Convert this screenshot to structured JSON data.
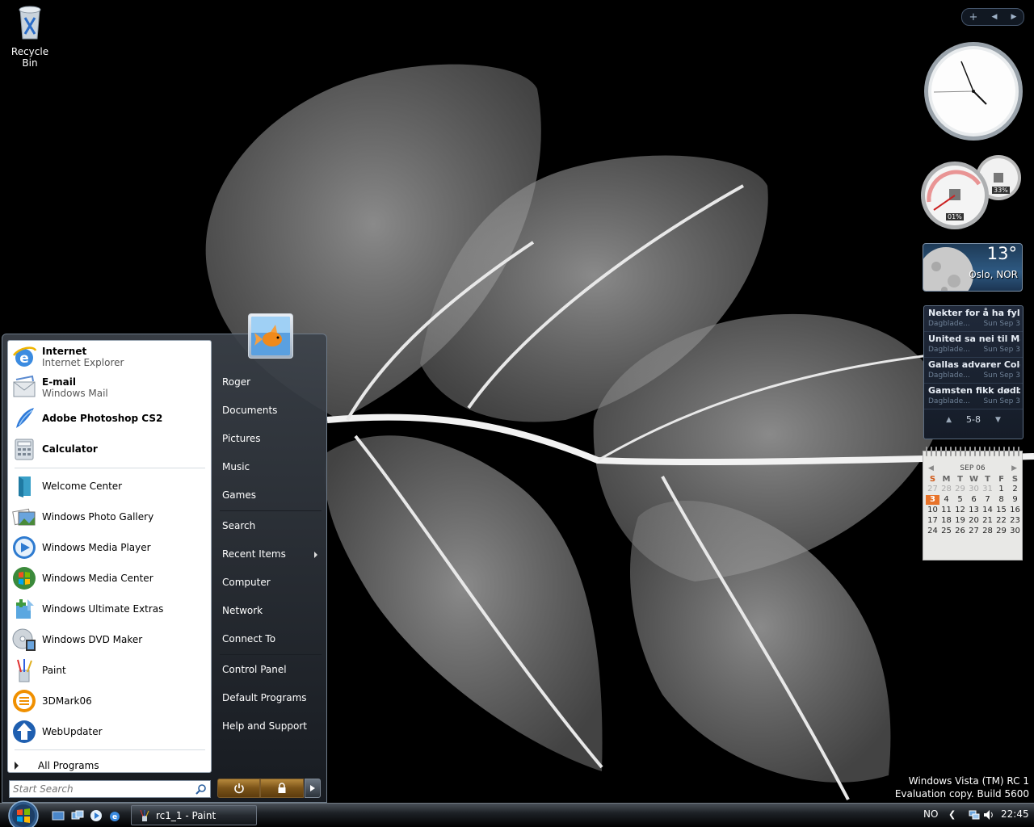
{
  "desktop": {
    "recycle_bin_label": "Recycle Bin",
    "watermark_line1": "Windows Vista (TM) RC 1",
    "watermark_line2": "Evaluation copy. Build 5600"
  },
  "sidebar": {
    "toolbar": {
      "add_label": "+",
      "prev_label": "◀",
      "next_label": "▶"
    },
    "meter": {
      "cpu_text": "01%",
      "memory_text": "33%"
    },
    "weather": {
      "temperature": "13°",
      "city": "Oslo, NOR"
    },
    "feed": {
      "items": [
        {
          "title": "Nekter for å ha fyllek...",
          "source": "Dagblade...",
          "date": "Sun Sep 3"
        },
        {
          "title": "United sa nei til Masc...",
          "source": "Dagblade...",
          "date": "Sun Sep 3"
        },
        {
          "title": "Gallas advarer Cole ...",
          "source": "Dagblade...",
          "date": "Sun Sep 3"
        },
        {
          "title": "Gamsten fikk dødball...",
          "source": "Dagblade...",
          "date": "Sun Sep 3"
        }
      ],
      "range": "5-8",
      "up_arrow": "▲",
      "down_arrow": "▼"
    },
    "calendar": {
      "month": "SEP 06",
      "prev": "◀",
      "next": "▶",
      "weekdays": [
        "S",
        "M",
        "T",
        "W",
        "T",
        "F",
        "S"
      ],
      "weeks": [
        [
          "27",
          "28",
          "29",
          "30",
          "31",
          "1",
          "2"
        ],
        [
          "3",
          "4",
          "5",
          "6",
          "7",
          "8",
          "9"
        ],
        [
          "10",
          "11",
          "12",
          "13",
          "14",
          "15",
          "16"
        ],
        [
          "17",
          "18",
          "19",
          "20",
          "21",
          "22",
          "23"
        ],
        [
          "24",
          "25",
          "26",
          "27",
          "28",
          "29",
          "30"
        ]
      ],
      "today": "3"
    }
  },
  "start_menu": {
    "pinned": [
      {
        "title": "Internet",
        "subtitle": "Internet Explorer",
        "icon": "internet-explorer-icon"
      },
      {
        "title": "E-mail",
        "subtitle": "Windows Mail",
        "icon": "windows-mail-icon"
      }
    ],
    "recent": [
      {
        "title": "Adobe Photoshop CS2",
        "icon": "photoshop-icon"
      },
      {
        "title": "Calculator",
        "icon": "calculator-icon"
      }
    ],
    "programs": [
      {
        "title": "Welcome Center",
        "icon": "welcome-center-icon"
      },
      {
        "title": "Windows Photo Gallery",
        "icon": "photo-gallery-icon"
      },
      {
        "title": "Windows Media Player",
        "icon": "media-player-icon"
      },
      {
        "title": "Windows Media Center",
        "icon": "media-center-icon"
      },
      {
        "title": "Windows Ultimate Extras",
        "icon": "ultimate-extras-icon"
      },
      {
        "title": "Windows DVD Maker",
        "icon": "dvd-maker-icon"
      },
      {
        "title": "Paint",
        "icon": "paint-icon"
      },
      {
        "title": "3DMark06",
        "icon": "3dmark-icon"
      },
      {
        "title": "WebUpdater",
        "icon": "webupdater-icon"
      }
    ],
    "all_programs": "All Programs",
    "search_placeholder": "Start Search",
    "right_items": [
      {
        "label": "Roger"
      },
      {
        "label": "Documents"
      },
      {
        "label": "Pictures"
      },
      {
        "label": "Music"
      },
      {
        "label": "Games"
      },
      {
        "label": "Search"
      },
      {
        "label": "Recent Items"
      },
      {
        "label": "Computer"
      },
      {
        "label": "Network"
      },
      {
        "label": "Connect To"
      },
      {
        "label": "Control Panel"
      },
      {
        "label": "Default Programs"
      },
      {
        "label": "Help and Support"
      }
    ]
  },
  "taskbar": {
    "task_label": "rc1_1 - Paint",
    "language": "NO",
    "time": "22:45"
  }
}
